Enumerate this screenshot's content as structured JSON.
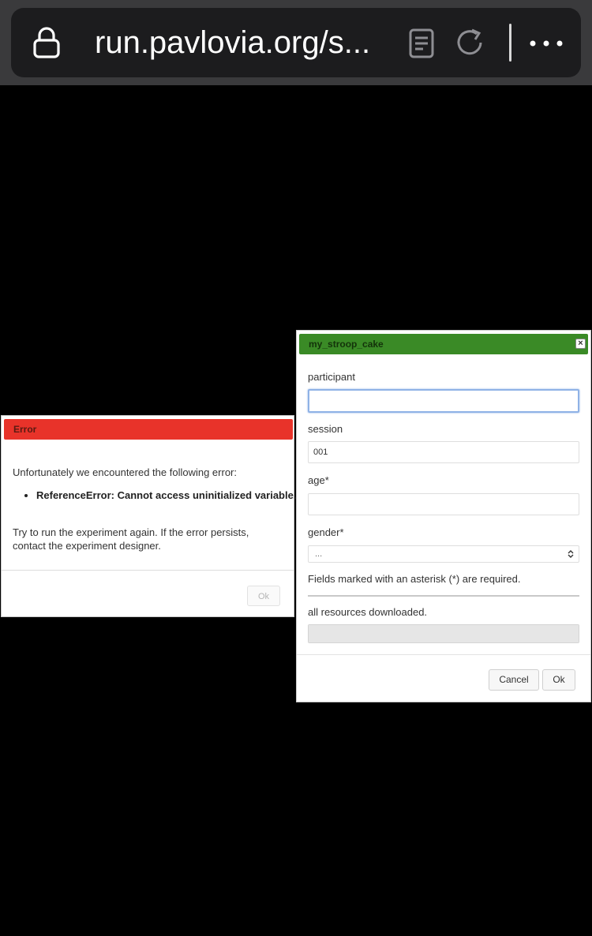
{
  "browser": {
    "url": "run.pavlovia.org/s..."
  },
  "error_dialog": {
    "title": "Error",
    "title_color": "#e8332a",
    "intro": "Unfortunately we encountered the following error:",
    "error_item": "ReferenceError: Cannot access uninitialized variable.",
    "hint": "Try to run the experiment again. If the error persists, contact the experiment designer.",
    "ok_label": "Ok"
  },
  "info_dialog": {
    "title": "my_stroop_cake",
    "title_color": "#3a8a26",
    "close_symbol": "×",
    "fields": {
      "participant": {
        "label": "participant",
        "value": ""
      },
      "session": {
        "label": "session",
        "value": "001"
      },
      "age": {
        "label": "age*",
        "value": ""
      },
      "gender": {
        "label": "gender*",
        "selected": "..."
      }
    },
    "required_note": "Fields marked with an asterisk (*) are required.",
    "progress_text": "all resources downloaded.",
    "progress_fraction": 1.0,
    "cancel_label": "Cancel",
    "ok_label": "Ok"
  }
}
